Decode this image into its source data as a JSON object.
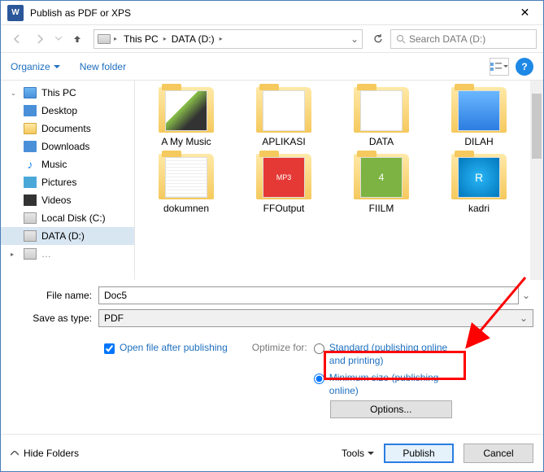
{
  "window": {
    "title": "Publish as PDF or XPS"
  },
  "nav": {
    "breadcrumb": [
      "This PC",
      "DATA (D:)"
    ],
    "search_placeholder": "Search DATA (D:)"
  },
  "toolbar": {
    "organize": "Organize",
    "new_folder": "New folder"
  },
  "sidebar": {
    "root": "This PC",
    "items": [
      {
        "label": "Desktop",
        "icon": "desktop"
      },
      {
        "label": "Documents",
        "icon": "folder"
      },
      {
        "label": "Downloads",
        "icon": "down"
      },
      {
        "label": "Music",
        "icon": "music"
      },
      {
        "label": "Pictures",
        "icon": "pic"
      },
      {
        "label": "Videos",
        "icon": "video"
      },
      {
        "label": "Local Disk (C:)",
        "icon": "drive"
      },
      {
        "label": "DATA (D:)",
        "icon": "drive",
        "selected": true
      }
    ]
  },
  "folders": [
    {
      "name": "A My Music",
      "thumb": "music"
    },
    {
      "name": "APLIKASI",
      "thumb": "docs"
    },
    {
      "name": "DATA",
      "thumb": "docs"
    },
    {
      "name": "DILAH",
      "thumb": "blue"
    },
    {
      "name": "dokumnen",
      "thumb": "docs"
    },
    {
      "name": "FFOutput",
      "thumb": "mp3"
    },
    {
      "name": "FIILM",
      "thumb": "green"
    },
    {
      "name": "kadri",
      "thumb": "blue2"
    }
  ],
  "form": {
    "filename_label": "File name:",
    "filename_value": "Doc5",
    "savetype_label": "Save as type:",
    "savetype_value": "PDF"
  },
  "options": {
    "open_after": "Open file after publishing",
    "optimize_label": "Optimize for:",
    "standard": "Standard (publishing online and printing)",
    "minimum": "Minimum size (publishing online)",
    "options_btn": "Options..."
  },
  "footer": {
    "hide_folders": "Hide Folders",
    "tools": "Tools",
    "publish": "Publish",
    "cancel": "Cancel"
  }
}
